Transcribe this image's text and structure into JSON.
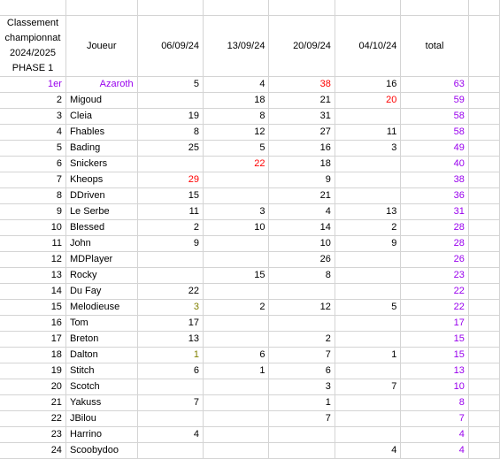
{
  "sheet": {
    "title_lines": [
      "Classement",
      "championnat",
      "2024/2025",
      "PHASE 1"
    ],
    "columns": {
      "player": "Joueur",
      "dates": [
        "06/09/24",
        "13/09/24",
        "20/09/24",
        "04/10/24"
      ],
      "total": "total"
    },
    "colors": {
      "leader": "#9900ee",
      "total": "#9900ee",
      "highlight": "#ff0000",
      "grid": "#d4d4d4",
      "text": "#000000"
    },
    "rows": [
      {
        "rank": "1er",
        "name": "Azaroth",
        "scores": [
          "5",
          "4",
          "38",
          "16"
        ],
        "total": "63",
        "leader": true,
        "hi": [
          false,
          false,
          true,
          false
        ],
        "big": [
          false,
          false,
          false,
          false
        ]
      },
      {
        "rank": "2",
        "name": "Migoud",
        "scores": [
          "",
          "18",
          "21",
          "20"
        ],
        "total": "59",
        "leader": false,
        "hi": [
          false,
          false,
          false,
          true
        ],
        "big": [
          false,
          false,
          false,
          false
        ]
      },
      {
        "rank": "3",
        "name": "Cleia",
        "scores": [
          "19",
          "8",
          "31",
          ""
        ],
        "total": "58",
        "leader": false,
        "hi": [
          false,
          false,
          false,
          false
        ],
        "big": [
          false,
          false,
          false,
          false
        ]
      },
      {
        "rank": "4",
        "name": "Fhables",
        "scores": [
          "8",
          "12",
          "27",
          "11"
        ],
        "total": "58",
        "leader": false,
        "hi": [
          false,
          false,
          false,
          false
        ],
        "big": [
          false,
          false,
          false,
          false
        ]
      },
      {
        "rank": "5",
        "name": "Bading",
        "scores": [
          "25",
          "5",
          "16",
          "3"
        ],
        "total": "49",
        "leader": false,
        "hi": [
          false,
          false,
          false,
          false
        ],
        "big": [
          false,
          false,
          false,
          false
        ]
      },
      {
        "rank": "6",
        "name": "Snickers",
        "scores": [
          "",
          "22",
          "18",
          ""
        ],
        "total": "40",
        "leader": false,
        "hi": [
          false,
          true,
          false,
          false
        ],
        "big": [
          false,
          false,
          false,
          false
        ]
      },
      {
        "rank": "7",
        "name": "Kheops",
        "scores": [
          "29",
          "",
          "9",
          ""
        ],
        "total": "38",
        "leader": false,
        "hi": [
          true,
          false,
          false,
          false
        ],
        "big": [
          false,
          false,
          false,
          false
        ]
      },
      {
        "rank": "8",
        "name": "DDriven",
        "scores": [
          "15",
          "",
          "21",
          ""
        ],
        "total": "36",
        "leader": false,
        "hi": [
          false,
          false,
          false,
          false
        ],
        "big": [
          false,
          false,
          false,
          false
        ]
      },
      {
        "rank": "9",
        "name": "Le Serbe",
        "scores": [
          "11",
          "3",
          "4",
          "13"
        ],
        "total": "31",
        "leader": false,
        "hi": [
          false,
          false,
          false,
          false
        ],
        "big": [
          false,
          false,
          false,
          false
        ]
      },
      {
        "rank": "10",
        "name": "Blessed",
        "scores": [
          "2",
          "10",
          "14",
          "2"
        ],
        "total": "28",
        "leader": false,
        "hi": [
          false,
          false,
          false,
          false
        ],
        "big": [
          false,
          false,
          false,
          false
        ]
      },
      {
        "rank": "11",
        "name": "John",
        "scores": [
          "9",
          "",
          "10",
          "9"
        ],
        "total": "28",
        "leader": false,
        "hi": [
          false,
          false,
          false,
          false
        ],
        "big": [
          false,
          false,
          false,
          false
        ]
      },
      {
        "rank": "12",
        "name": "MDPlayer",
        "scores": [
          "",
          "",
          "26",
          ""
        ],
        "total": "26",
        "leader": false,
        "hi": [
          false,
          false,
          false,
          false
        ],
        "big": [
          false,
          false,
          false,
          false
        ]
      },
      {
        "rank": "13",
        "name": "Rocky",
        "scores": [
          "",
          "15",
          "8",
          ""
        ],
        "total": "23",
        "leader": false,
        "hi": [
          false,
          false,
          false,
          false
        ],
        "big": [
          false,
          false,
          false,
          false
        ]
      },
      {
        "rank": "14",
        "name": "Du Fay",
        "scores": [
          "22",
          "",
          "",
          ""
        ],
        "total": "22",
        "leader": false,
        "hi": [
          false,
          false,
          false,
          false
        ],
        "big": [
          false,
          false,
          false,
          false
        ]
      },
      {
        "rank": "15",
        "name": "Melodieuse",
        "scores": [
          "3",
          "2",
          "12",
          "5"
        ],
        "total": "22",
        "leader": false,
        "hi": [
          false,
          false,
          false,
          false
        ],
        "big": [
          true,
          false,
          false,
          false
        ]
      },
      {
        "rank": "16",
        "name": "Tom",
        "scores": [
          "17",
          "",
          "",
          ""
        ],
        "total": "17",
        "leader": false,
        "hi": [
          false,
          false,
          false,
          false
        ],
        "big": [
          false,
          false,
          false,
          false
        ]
      },
      {
        "rank": "17",
        "name": "Breton",
        "scores": [
          "13",
          "",
          "2",
          ""
        ],
        "total": "15",
        "leader": false,
        "hi": [
          false,
          false,
          false,
          false
        ],
        "big": [
          false,
          false,
          false,
          false
        ]
      },
      {
        "rank": "18",
        "name": "Dalton",
        "scores": [
          "1",
          "6",
          "7",
          "1"
        ],
        "total": "15",
        "leader": false,
        "hi": [
          false,
          false,
          false,
          false
        ],
        "big": [
          true,
          false,
          false,
          false
        ]
      },
      {
        "rank": "19",
        "name": "Stitch",
        "scores": [
          "6",
          "1",
          "6",
          ""
        ],
        "total": "13",
        "leader": false,
        "hi": [
          false,
          false,
          false,
          false
        ],
        "big": [
          false,
          false,
          false,
          false
        ]
      },
      {
        "rank": "20",
        "name": "Scotch",
        "scores": [
          "",
          "",
          "3",
          "7"
        ],
        "total": "10",
        "leader": false,
        "hi": [
          false,
          false,
          false,
          false
        ],
        "big": [
          false,
          false,
          false,
          false
        ]
      },
      {
        "rank": "21",
        "name": "Yakuss",
        "scores": [
          "7",
          "",
          "1",
          ""
        ],
        "total": "8",
        "leader": false,
        "hi": [
          false,
          false,
          false,
          false
        ],
        "big": [
          false,
          false,
          false,
          false
        ]
      },
      {
        "rank": "22",
        "name": "JBilou",
        "scores": [
          "",
          "",
          "7",
          ""
        ],
        "total": "7",
        "leader": false,
        "hi": [
          false,
          false,
          false,
          false
        ],
        "big": [
          false,
          false,
          false,
          false
        ]
      },
      {
        "rank": "23",
        "name": "Harrino",
        "scores": [
          "4",
          "",
          "",
          ""
        ],
        "total": "4",
        "leader": false,
        "hi": [
          false,
          false,
          false,
          false
        ],
        "big": [
          false,
          false,
          false,
          false
        ]
      },
      {
        "rank": "24",
        "name": "Scoobydoo",
        "scores": [
          "",
          "",
          "",
          "4"
        ],
        "total": "4",
        "leader": false,
        "hi": [
          false,
          false,
          false,
          false
        ],
        "big": [
          false,
          false,
          false,
          false
        ]
      }
    ]
  }
}
